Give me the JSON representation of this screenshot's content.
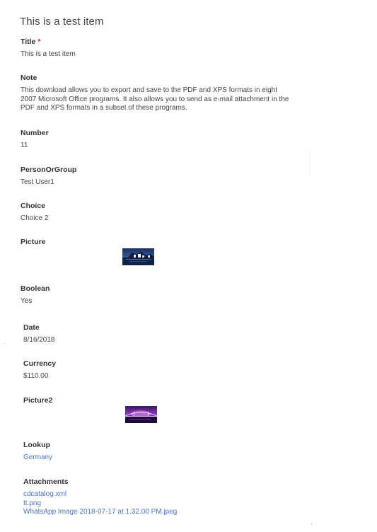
{
  "item": {
    "title": "This is a test item"
  },
  "fields": {
    "title": {
      "label": "Title",
      "required_marker": "*",
      "value": "This is a test item"
    },
    "note": {
      "label": "Note",
      "value": "This download allows you to export and save to the PDF and XPS formats in eight 2007 Microsoft Office programs. It also allows you to send as e-mail attachment in the PDF and XPS formats in a subset of these programs."
    },
    "number": {
      "label": "Number",
      "value": "11"
    },
    "person": {
      "label": "PersonOrGroup",
      "value": "Test User1"
    },
    "choice": {
      "label": "Choice",
      "value": "Choice 2"
    },
    "picture": {
      "label": "Picture",
      "image": "night-harbor-picture"
    },
    "boolean": {
      "label": "Boolean",
      "value": "Yes"
    },
    "date": {
      "label": "Date",
      "value": "8/16/2018"
    },
    "currency": {
      "label": "Currency",
      "value": "$110.00"
    },
    "picture2": {
      "label": "Picture2",
      "image": "purple-bridge-picture"
    },
    "lookup": {
      "label": "Lookup",
      "value": "Germany"
    },
    "attachments": {
      "label": "Attachments",
      "items": [
        "cdcatalog.xml",
        "tt.png",
        "WhatsApp Image 2018-07-17 at 1.32.00 PM.jpeg"
      ]
    }
  },
  "colors": {
    "link": "#4a73c9",
    "required": "#c4262e",
    "text": "#444444"
  }
}
